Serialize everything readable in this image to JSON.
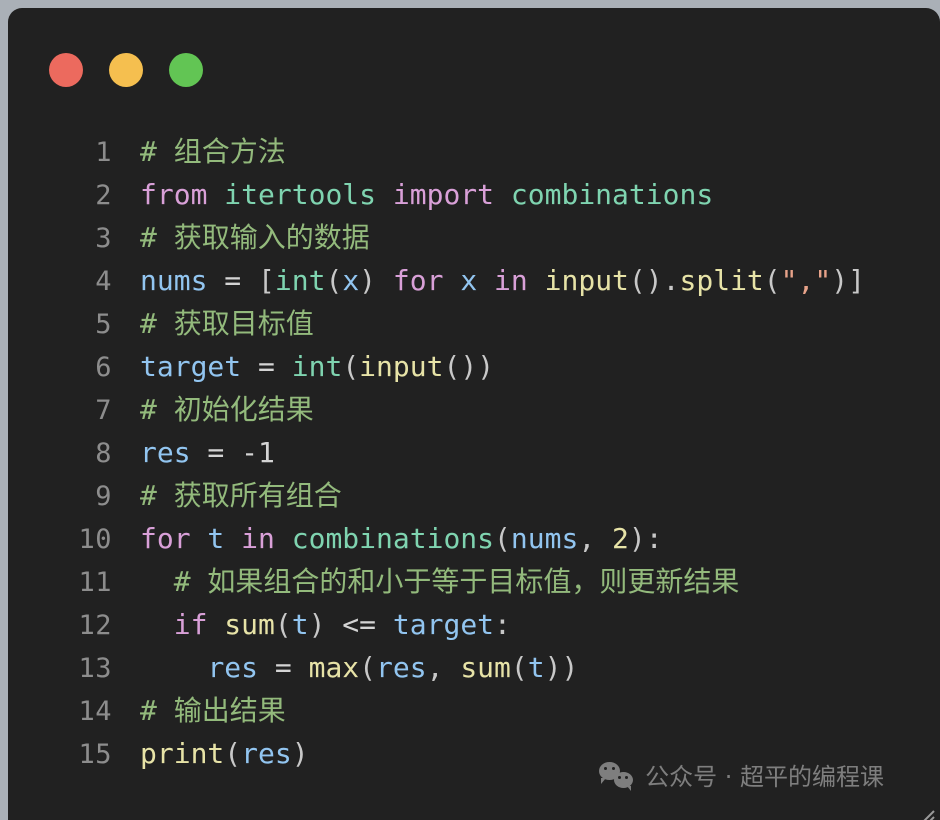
{
  "window": {
    "title_bar": {
      "buttons": [
        {
          "name": "close-button",
          "color": "#ec6a5e",
          "label": ""
        },
        {
          "name": "minimize-button",
          "color": "#f5bf4f",
          "label": ""
        },
        {
          "name": "maximize-button",
          "color": "#62c554",
          "label": ""
        }
      ]
    },
    "background": "#212121",
    "page_background": "#aab0b7"
  },
  "editor": {
    "language": "python",
    "line_numbers": [
      "1",
      "2",
      "3",
      "4",
      "5",
      "6",
      "7",
      "8",
      "9",
      "10",
      "11",
      "12",
      "13",
      "14",
      "15"
    ],
    "lines": [
      {
        "n": "1",
        "text": "# 组合方法"
      },
      {
        "n": "2",
        "text": "from itertools import combinations"
      },
      {
        "n": "3",
        "text": "# 获取输入的数据"
      },
      {
        "n": "4",
        "text": "nums = [int(x) for x in input().split(\",\")]"
      },
      {
        "n": "5",
        "text": "# 获取目标值"
      },
      {
        "n": "6",
        "text": "target = int(input())"
      },
      {
        "n": "7",
        "text": "# 初始化结果"
      },
      {
        "n": "8",
        "text": "res = -1"
      },
      {
        "n": "9",
        "text": "# 获取所有组合"
      },
      {
        "n": "10",
        "text": "for t in combinations(nums, 2):"
      },
      {
        "n": "11",
        "text": "  # 如果组合的和小于等于目标值，则更新结果"
      },
      {
        "n": "12",
        "text": "  if sum(t) <= target:"
      },
      {
        "n": "13",
        "text": "    res = max(res, sum(t))"
      },
      {
        "n": "14",
        "text": "# 输出结果"
      },
      {
        "n": "15",
        "text": "print(res)"
      }
    ],
    "tokens": {
      "line1": {
        "comment": "# 组合方法"
      },
      "line2": {
        "kw_from": "from",
        "mod": "itertools",
        "kw_import": "import",
        "name": "combinations"
      },
      "line3": {
        "comment": "# 获取输入的数据"
      },
      "line4": {
        "var": "nums",
        "eq": " = ",
        "br_open": "[",
        "fn_int": "int",
        "p1": "(",
        "x1": "x",
        "p2": ")",
        "kw_for": " for ",
        "x2": "x",
        "kw_in": " in ",
        "fn_input": "input",
        "p3": "()",
        "dot": ".",
        "fn_split": "split",
        "p4": "(",
        "str": "\",\"",
        "p5": ")",
        "br_close": "]"
      },
      "line5": {
        "comment": "# 获取目标值"
      },
      "line6": {
        "var": "target",
        "eq": " = ",
        "fn_int": "int",
        "p1": "(",
        "fn_input": "input",
        "p2": "()",
        "p3": ")"
      },
      "line7": {
        "comment": "# 初始化结果"
      },
      "line8": {
        "var": "res",
        "eq": " = ",
        "num": "-1"
      },
      "line9": {
        "comment": "# 获取所有组合"
      },
      "line10": {
        "kw_for": "for",
        "var_t": " t ",
        "kw_in": "in",
        "fn": " combinations",
        "p1": "(",
        "arg": "nums",
        "comma": ", ",
        "num": "2",
        "p2": "):"
      },
      "line11": {
        "indent": "  ",
        "comment": "# 如果组合的和小于等于目标值，则更新结果"
      },
      "line12": {
        "indent": "  ",
        "kw_if": "if",
        "fn_sum": " sum",
        "p1": "(",
        "arg": "t",
        "p2": ")",
        "op": " <= ",
        "var": "target",
        "colon": ":"
      },
      "line13": {
        "indent": "    ",
        "var": "res",
        "eq": " = ",
        "fn_max": "max",
        "p1": "(",
        "arg1": "res",
        "comma": ", ",
        "fn_sum": "sum",
        "p2": "(",
        "arg2": "t",
        "p3": "))"
      },
      "line14": {
        "comment": "# 输出结果"
      },
      "line15": {
        "fn_print": "print",
        "p1": "(",
        "arg": "res",
        "p2": ")"
      }
    }
  },
  "watermark": {
    "icon": "wechat-icon",
    "text": "公众号 · 超平的编程课"
  },
  "colors": {
    "comment": "#93ba7c",
    "keyword": "#d9a0d8",
    "function": "#7fd4b0",
    "variable": "#92c5f0",
    "builtin": "#e7e3a7",
    "string": "#e8a38a",
    "punctuation": "#c8c8c8",
    "line_number": "#8d8d8d"
  }
}
